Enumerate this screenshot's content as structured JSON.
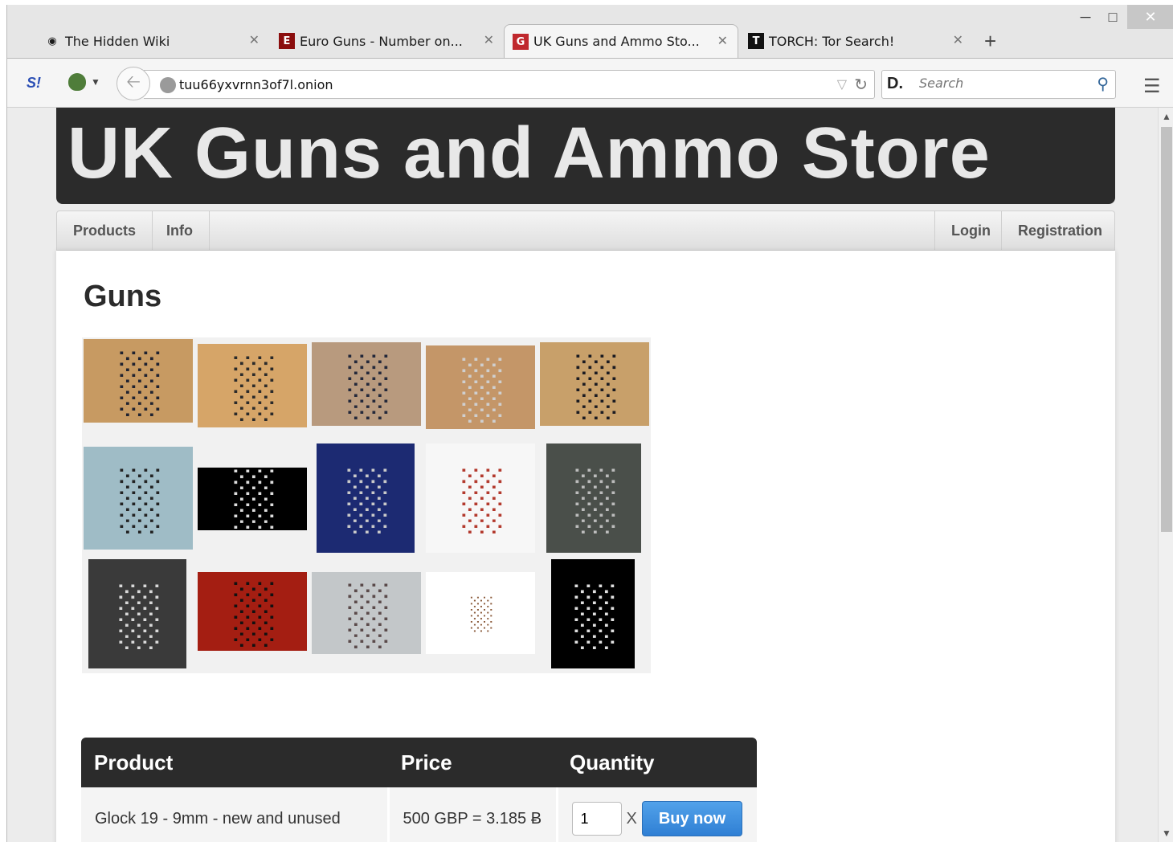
{
  "browser": {
    "tabs": [
      {
        "title": "The Hidden Wiki",
        "icon": "onion-icon"
      },
      {
        "title": "Euro Guns - Number on...",
        "icon": "e-logo-icon"
      },
      {
        "title": "UK Guns and Ammo Sto...",
        "icon": "g-logo-icon"
      },
      {
        "title": "TORCH: Tor Search!",
        "icon": "t-logo-icon"
      }
    ],
    "active_tab_index": 2,
    "url": "tuu66yxvrnn3of7l.onion",
    "search_placeholder": "Search",
    "colors": {
      "chrome": "#e6e6e6",
      "close_button": "#c7c7c7"
    }
  },
  "page": {
    "banner_title": "UK Guns and Ammo Store",
    "nav": {
      "left": [
        "Products",
        "Info"
      ],
      "right": [
        "Login",
        "Registration"
      ]
    },
    "heading": "Guns",
    "gallery": {
      "count": 15
    },
    "table": {
      "headers": [
        "Product",
        "Price",
        "Quantity"
      ],
      "rows": [
        {
          "product": "Glock 19 - 9mm - new and unused",
          "price": "500 GBP = 3.185 Ƀ",
          "quantity": "1",
          "times": "X",
          "button": "Buy now"
        }
      ]
    },
    "colors": {
      "banner": "#2b2b2b",
      "buy_button": "#3a8ee0"
    }
  }
}
